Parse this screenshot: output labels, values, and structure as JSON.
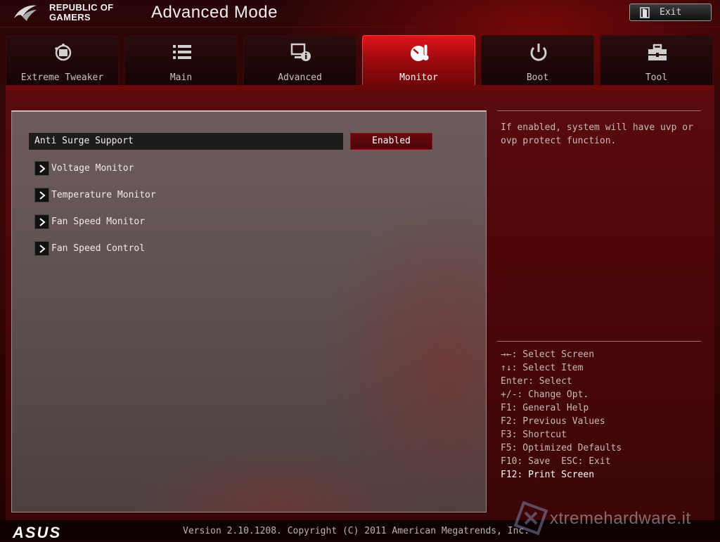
{
  "header": {
    "brand_line1": "REPUBLIC OF",
    "brand_line2": "GAMERS",
    "title": "Advanced Mode",
    "exit_label": "Exit"
  },
  "tabs": [
    {
      "label": "Extreme Tweaker",
      "icon": "tweaker-icon",
      "active": false
    },
    {
      "label": "Main",
      "icon": "list-icon",
      "active": false
    },
    {
      "label": "Advanced",
      "icon": "advanced-info-icon",
      "active": false
    },
    {
      "label": "Monitor",
      "icon": "thermometer-gauge-icon",
      "active": true
    },
    {
      "label": "Boot",
      "icon": "power-icon",
      "active": false
    },
    {
      "label": "Tool",
      "icon": "toolbox-icon",
      "active": false
    }
  ],
  "settings": {
    "anti_surge": {
      "label": "Anti Surge Support",
      "value": "Enabled"
    }
  },
  "submenus": [
    {
      "label": "Voltage Monitor"
    },
    {
      "label": "Temperature Monitor"
    },
    {
      "label": "Fan Speed Monitor"
    },
    {
      "label": "Fan Speed Control"
    }
  ],
  "help": {
    "line1": "If enabled, system will have uvp or",
    "line2": "ovp protect function."
  },
  "keys": [
    "→←: Select Screen",
    "↑↓: Select Item",
    "Enter: Select",
    "+/-: Change Opt.",
    "F1: General Help",
    "F2: Previous Values",
    "F3: Shortcut",
    "F5: Optimized Defaults",
    "F10: Save  ESC: Exit",
    "F12: Print Screen"
  ],
  "footer": {
    "brand": "ASUS",
    "version": "Version 2.10.1208. Copyright (C) 2011 American Megatrends, Inc.",
    "watermark": "xtremehardware.it"
  },
  "colors": {
    "accent": "#e0141c",
    "setting_value_bg": "#6a0a0c",
    "panel_bg": "#5e5150"
  }
}
